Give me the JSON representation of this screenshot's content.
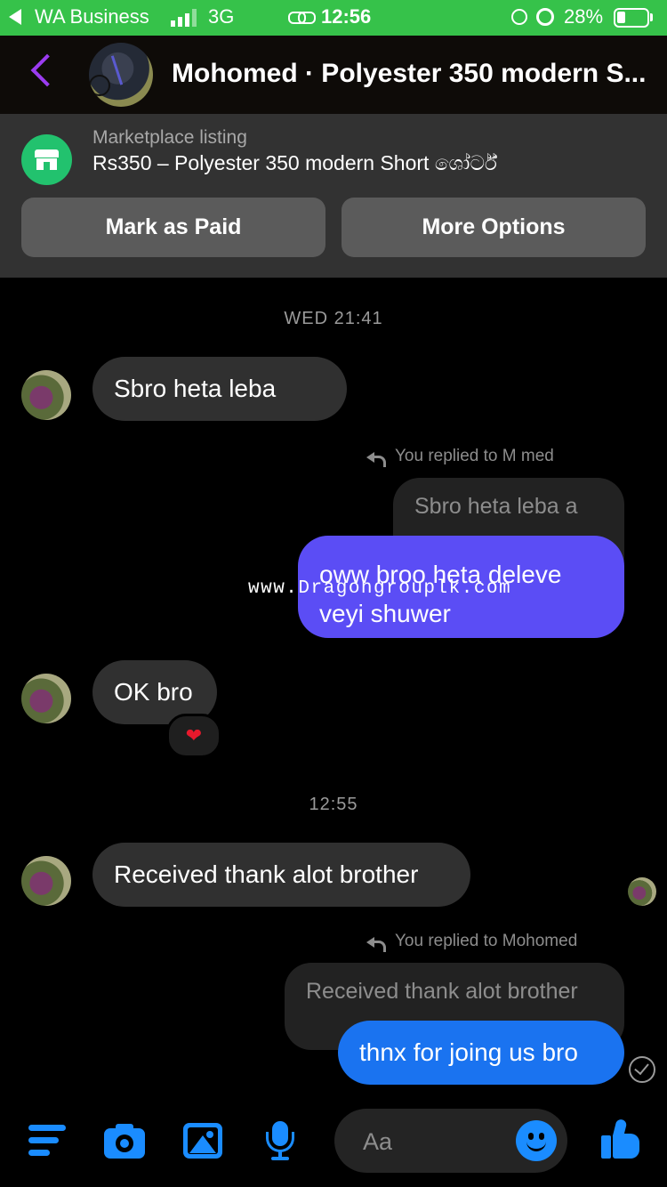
{
  "status_bar": {
    "back_label": "WA Business",
    "network": "3G",
    "time": "12:56",
    "battery": "28%",
    "icons": [
      "back-arrow-icon",
      "signal-icon",
      "link-icon",
      "rotation-lock-icon",
      "alarm-icon",
      "battery-icon"
    ]
  },
  "header": {
    "title": "Mohomed · Polyester 350 modern S...",
    "back_icon": "chevron-left-icon",
    "accent_color": "#9b3cf0"
  },
  "listing": {
    "label": "Marketplace listing",
    "title": "Rs350 – Polyester 350 modern Short ශෝර්ට්",
    "icon": "storefront-icon",
    "mark_paid_label": "Mark as Paid",
    "more_options_label": "More Options"
  },
  "messages": {
    "timestamp_1": "WED 21:41",
    "msg1": "Sbro heta leba ",
    "reply1_label": "You replied to M    med",
    "reply1_quote": "Sbro heta leba   a",
    "reply1_line1": "oww broo heta deleve",
    "reply1_line2": "veyi shuwer",
    "watermark": "www.Dragongrouplk.com",
    "msg2": "OK bro",
    "msg2_reaction": "❤",
    "timestamp_2": "12:55",
    "msg3": "Received thank alot brother",
    "reply2_label": "You replied to Mohomed",
    "reply2_quote": "Received thank alot brother",
    "reply2_text": "thnx for joing us bro"
  },
  "composer": {
    "placeholder": "Aa",
    "tools": [
      "menu-icon",
      "camera-icon",
      "image-icon",
      "microphone-icon",
      "emoji-icon",
      "thumbs-up-icon"
    ],
    "accent_color": "#1a8cff"
  }
}
